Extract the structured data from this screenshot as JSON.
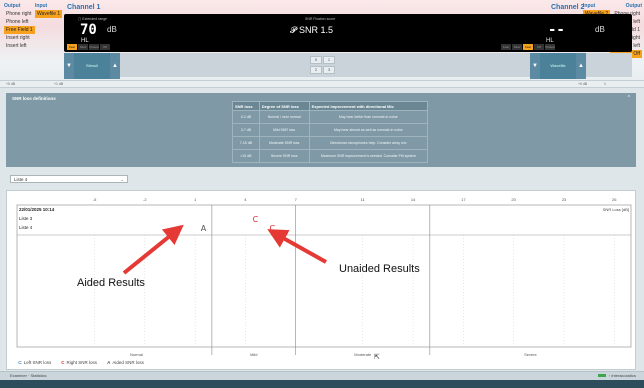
{
  "left_io": {
    "output_header": "Output",
    "input_header": "Input",
    "output_items": [
      "Phone right",
      "Phone left",
      "Free Field 1",
      "Insert right",
      "Insert left"
    ],
    "output_selected": 2,
    "input_items": [
      "Wavefile 1"
    ],
    "input_selected": 0
  },
  "right_io": {
    "input_header": "Input",
    "output_header": "Output",
    "input_items": [
      "Wavefile 2"
    ],
    "input_selected": 0,
    "output_items": [
      "Phone right",
      "Phone left",
      "Free Field 1",
      "Insert right",
      "Insert left",
      "Off"
    ],
    "output_selected": 5
  },
  "channel1": {
    "title": "Channel 1",
    "level_label": "Extended range",
    "value": "70",
    "unit": "dB",
    "mode": "HL"
  },
  "channel2": {
    "title": "Channel 2",
    "value": "--",
    "unit": "dB",
    "mode": "HL"
  },
  "center": {
    "label": "SNR Fixation score",
    "snr": "SNR 1.5"
  },
  "filters_left": [
    "Fast",
    "Slow",
    "Pulsed",
    "Off"
  ],
  "filters_left_on": 0,
  "filters_right": [
    "Fast",
    "Slow",
    "Fast",
    "Off",
    "Pulsed"
  ],
  "filters_right_on": 2,
  "knob_left_label": "Stimuli",
  "knob_right_label": "Wavefile",
  "center_buttons": [
    "0",
    "1",
    "2",
    "3"
  ],
  "ruler": {
    "left_a": "+0 dB",
    "left_b": "+1 dB",
    "right_a": "+0 dB",
    "right_b": "1"
  },
  "snr_panel": {
    "title": "SNR loss definitions",
    "headers": [
      "SNR loss",
      "Degree of SNR loss",
      "Expected improvement with directional Mic"
    ],
    "rows": [
      [
        "0-2 dB",
        "Normal / near normal",
        "May hear better than normals in noise"
      ],
      [
        "3-7 dB",
        "Mild SNR loss",
        "May hear almost as well as normals in noise"
      ],
      [
        "7-15 dB",
        "Moderate SNR loss",
        "Directional microphones help. Consider array mic"
      ],
      [
        ">15 dB",
        "Severe SNR loss",
        "Maximum SNR improvement is needed. Consider FM system"
      ]
    ]
  },
  "list_select": {
    "value": "Liste 4"
  },
  "chart": {
    "date": "22/01/2025 10:14",
    "rows": [
      "Liste 3",
      "Liste 4"
    ],
    "unit_label": "SNR Loss [dB]",
    "categories": [
      "Normal",
      "Mild",
      "Moderate",
      "Severe"
    ],
    "x_ticks": [
      "-5",
      "-2",
      "1",
      "4",
      "7",
      "11",
      "14",
      "17",
      "20",
      "23",
      "26"
    ]
  },
  "chart_data": {
    "type": "scatter",
    "x_ticks": [
      -5,
      -2,
      1,
      4,
      7,
      11,
      14,
      17,
      20,
      23,
      26
    ],
    "xlim": [
      -7,
      27
    ],
    "ylabel": "SNR Loss [dB]",
    "category_bands": [
      {
        "label": "Normal",
        "from": -7,
        "to": 2
      },
      {
        "label": "Mild",
        "from": 2,
        "to": 7
      },
      {
        "label": "Moderate",
        "from": 7,
        "to": 15
      },
      {
        "label": "Severe",
        "from": 15,
        "to": 27
      }
    ],
    "series": [
      {
        "name": "Aided SNR loss",
        "symbol": "A",
        "color": "#555555",
        "points": [
          {
            "x": 1.5,
            "row": "Liste 4"
          }
        ]
      },
      {
        "name": "Right SNR loss",
        "symbol": "C",
        "color": "#d62828",
        "points": [
          {
            "x": 4.6,
            "row": "Liste 3"
          },
          {
            "x": 5.6,
            "row": "Liste 4"
          }
        ]
      }
    ]
  },
  "annotations": {
    "aided": "Aided Results",
    "unaided": "Unaided Results"
  },
  "legend": [
    {
      "symbol": "⊂",
      "label": "Left SNR loss",
      "color": "#2a6fb0"
    },
    {
      "symbol": "C",
      "label": "Right SNR loss",
      "color": "#d62828"
    },
    {
      "symbol": "A",
      "label": "Aided SNR loss",
      "color": "#555555"
    }
  ],
  "status": {
    "left": "Examiner · Statistics",
    "right": "Interacoustics"
  },
  "colors": {
    "accent": "#f6a21f",
    "panel": "#7f9aa6",
    "right_ear": "#d62828",
    "arrow": "#e53935"
  }
}
